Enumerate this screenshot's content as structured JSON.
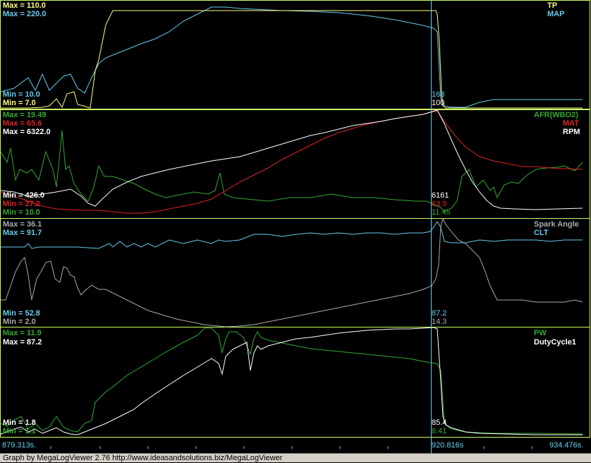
{
  "colors": {
    "yellow": "#ffff80",
    "cyan": "#66ccee",
    "green": "#33aa33",
    "red": "#dd2222",
    "white": "#ffffff",
    "grey": "#aaaaaa",
    "border_green": "#ccff66",
    "cursor": "#66ccee",
    "footer_bg": "#d4d0c8"
  },
  "panels": [
    {
      "labels": [
        {
          "text": "Max = 110.0",
          "color": "#ffff80"
        },
        {
          "text": "Max = 220.0",
          "color": "#66ccee"
        }
      ],
      "mins": [
        {
          "text": "Min = 10.0",
          "color": "#66ccee"
        },
        {
          "text": "Min = 7.0",
          "color": "#ffff80"
        }
      ],
      "names": [
        {
          "text": "TP",
          "color": "#ffff80"
        },
        {
          "text": "MAP",
          "color": "#66ccee"
        }
      ],
      "readouts": [
        {
          "text": "163",
          "color": "#66ccee"
        },
        {
          "text": "100",
          "color": "#ffffff"
        }
      ]
    },
    {
      "labels": [
        {
          "text": "Max = 19.49",
          "color": "#33aa33"
        },
        {
          "text": "Max = 65.6",
          "color": "#dd2222"
        },
        {
          "text": "Max = 6322.0",
          "color": "#ffffff"
        }
      ],
      "mins": [
        {
          "text": "Min = 426.0",
          "color": "#ffffff"
        },
        {
          "text": "Min = 27.2",
          "color": "#dd2222"
        },
        {
          "text": "Min = 10.0",
          "color": "#33aa33"
        }
      ],
      "names": [
        {
          "text": "AFR(WBO2)",
          "color": "#33aa33"
        },
        {
          "text": "MAT",
          "color": "#dd2222"
        },
        {
          "text": "RPM",
          "color": "#ffffff"
        }
      ],
      "readouts": [
        {
          "text": "6161",
          "color": "#ffffff"
        },
        {
          "text": "63.9",
          "color": "#dd2222"
        },
        {
          "text": "11.45",
          "color": "#33aa33"
        }
      ]
    },
    {
      "labels": [
        {
          "text": "Max = 36.1",
          "color": "#aaaaaa"
        },
        {
          "text": "Max = 91.7",
          "color": "#66ccee"
        }
      ],
      "mins": [
        {
          "text": "Min = 52.8",
          "color": "#66ccee"
        },
        {
          "text": "Min = 2.0",
          "color": "#aaaaaa"
        }
      ],
      "names": [
        {
          "text": "Spark Angle",
          "color": "#aaaaaa"
        },
        {
          "text": "CLT",
          "color": "#66ccee"
        }
      ],
      "readouts": [
        {
          "text": "87.2",
          "color": "#66ccee"
        },
        {
          "text": "14.3",
          "color": "#aaaaaa"
        }
      ]
    },
    {
      "labels": [
        {
          "text": "Max = 11.9",
          "color": "#33aa33"
        },
        {
          "text": "Max = 87.2",
          "color": "#ffffff"
        }
      ],
      "mins": [
        {
          "text": "Min = 1.8",
          "color": "#ffffff"
        },
        {
          "text": "Min = 1.1",
          "color": "#33aa33"
        }
      ],
      "names": [
        {
          "text": "PW",
          "color": "#33aa33"
        },
        {
          "text": "DutyCycle1",
          "color": "#ffffff"
        }
      ],
      "readouts": [
        {
          "text": "85.4",
          "color": "#ffffff"
        },
        {
          "text": "8.41",
          "color": "#33aa33"
        }
      ]
    }
  ],
  "time_axis": {
    "start": "879.313s.",
    "cursor": "920.816s",
    "end": "934.476s."
  },
  "footer": {
    "text": "Graph by MegaLogViewer 2.76 http://www.ideasandsolutions.biz/MegaLogViewer"
  }
}
